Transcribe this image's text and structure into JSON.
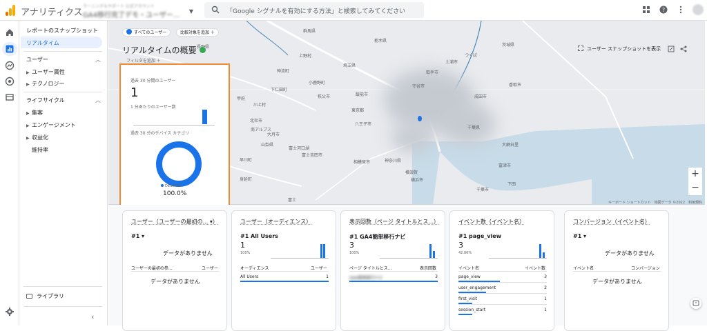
{
  "app": {
    "title": "アナリティクス",
    "account_line1": "ラーニング＆サポート 公式アカウント",
    "account_line2": "GA4移行完了デモ・ユーザー..."
  },
  "search": {
    "placeholder": "「Google シグナルを有効にする方法」と検索してみてください"
  },
  "sidebar": {
    "snapshot": "レポートのスナップショット",
    "realtime": "リアルタイム",
    "user_section": "ユーザー",
    "user_items": [
      "ユーザー属性",
      "テクノロジー"
    ],
    "lifecycle_section": "ライフサイクル",
    "lifecycle_items": [
      "集客",
      "エンゲージメント",
      "収益化",
      "維持率"
    ],
    "library": "ライブラリ"
  },
  "map": {
    "chip_all_users": "すべてのユーザー",
    "chip_compare": "比較対象を追加 ＋",
    "title": "リアルタイムの概要",
    "filter": "フィルタを追加 ＋",
    "snapshot_button": "ユーザー スナップショットを表示",
    "attribution": "キーボード ショートカット　地図データ ©2022　利用規約",
    "places": [
      "長野県",
      "群馬県",
      "栃木県",
      "茨城県",
      "上野村",
      "神流町",
      "埼玉県",
      "下仁田町",
      "川上村",
      "小鹿野町",
      "秩父市",
      "飯能市",
      "東京都",
      "八王子市",
      "北杜市",
      "大月市",
      "南アルプス",
      "山梨県",
      "富士河口湖",
      "早川町",
      "富士吉田市",
      "神奈川県",
      "相模原市",
      "横浜市",
      "横須賀",
      "千葉県",
      "富士",
      "身延町",
      "つくば",
      "土浦市",
      "取手市",
      "守谷市",
      "成田市",
      "千葉市",
      "香取市",
      "大網白里",
      "富津市",
      "下田",
      "甲府"
    ]
  },
  "realtime_card": {
    "users_label": "過去 30 分間のユーザー",
    "users_value": "1",
    "per_minute_label": "1 分あたりのユーザー数",
    "device_label": "過去 30 分のデバイス カテゴリ",
    "legend": "DESKTOP",
    "percent": "100.0%"
  },
  "cards": [
    {
      "title": "ユーザー（ユーザーの最初の... ▾）",
      "rank": "#1 ▾",
      "nodata_top": "データがありません",
      "col1": "ユーザーの最初の参...",
      "col2": "ユーザー",
      "nodata_bottom": "データがありません"
    },
    {
      "title": "ユーザー（オーディエンス）",
      "rank": "#1  All Users",
      "num": "1",
      "pct": "100%",
      "col1": "オーディエンス",
      "col2": "ユーザー",
      "rows": [
        {
          "k": "All Users",
          "v": "1"
        }
      ]
    },
    {
      "title": "表示回数（ページ タイトルとス...）",
      "rank": "#1  GA4簡単移行ナビ",
      "num": "3",
      "pct": "100%",
      "col1": "ページ タイトルとス...",
      "col2": "表示回数",
      "rows": [
        {
          "k": "GA4簡単移行ナビ",
          "v": "3"
        }
      ]
    },
    {
      "title": "イベント数（イベント名）",
      "rank": "#1  page_view",
      "num": "3",
      "pct": "42.86%",
      "col1": "イベント名",
      "col2": "イベント数",
      "rows": [
        {
          "k": "page_view",
          "v": "3"
        },
        {
          "k": "user_engagement",
          "v": "2"
        },
        {
          "k": "first_visit",
          "v": "1"
        },
        {
          "k": "session_start",
          "v": "1"
        }
      ]
    },
    {
      "title": "コンバージョン（イベント名）",
      "rank": "#1 ▾",
      "nodata_top": "データがありません",
      "col1": "イベント名",
      "col2": "コンバージョン",
      "nodata_bottom": "データがありません"
    }
  ],
  "colors": {
    "accent": "#1a73e8",
    "highlight": "#f28b30",
    "logo_orange": "#f9ab00",
    "logo_dark": "#e37400"
  }
}
